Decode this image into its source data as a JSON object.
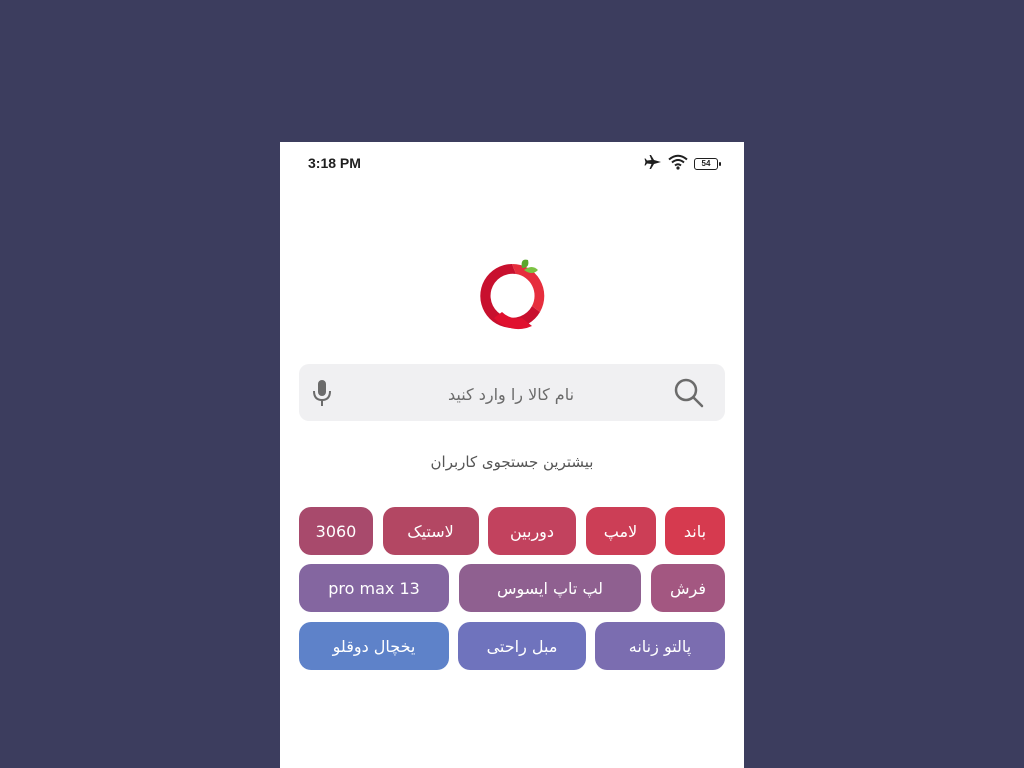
{
  "status_bar": {
    "time": "3:18 PM",
    "battery": "54",
    "icons": [
      "airplane-icon",
      "wifi-icon",
      "battery-icon"
    ]
  },
  "logo": {
    "icon": "fruit-logo-icon",
    "colors": {
      "ring": "#e0102e",
      "leaf": "#5aa62c"
    }
  },
  "search": {
    "placeholder": "نام کالا را وارد کنید",
    "value": "",
    "search_icon": "search-icon",
    "mic_icon": "microphone-icon"
  },
  "popular": {
    "title": "بیشترین جستجوی کاربران",
    "rows": [
      [
        {
          "label": "باند",
          "color": "#d63a4f"
        },
        {
          "label": "لامپ",
          "color": "#cc3e56"
        },
        {
          "label": "دوربین",
          "color": "#c2425e"
        },
        {
          "label": "لاستیک",
          "color": "#b34763"
        },
        {
          "label": "3060",
          "color": "#a84a6c"
        }
      ],
      [
        {
          "label": "فرش",
          "color": "#a35781"
        },
        {
          "label": "لپ تاپ ایسوس",
          "color": "#8f6090"
        },
        {
          "label": "13 pro max",
          "color": "#8466a0"
        }
      ],
      [
        {
          "label": "پالتو زنانه",
          "color": "#7b6db0"
        },
        {
          "label": "مبل راحتی",
          "color": "#6f73bd"
        },
        {
          "label": "یخچال دوقلو",
          "color": "#5e82c9"
        }
      ]
    ]
  }
}
